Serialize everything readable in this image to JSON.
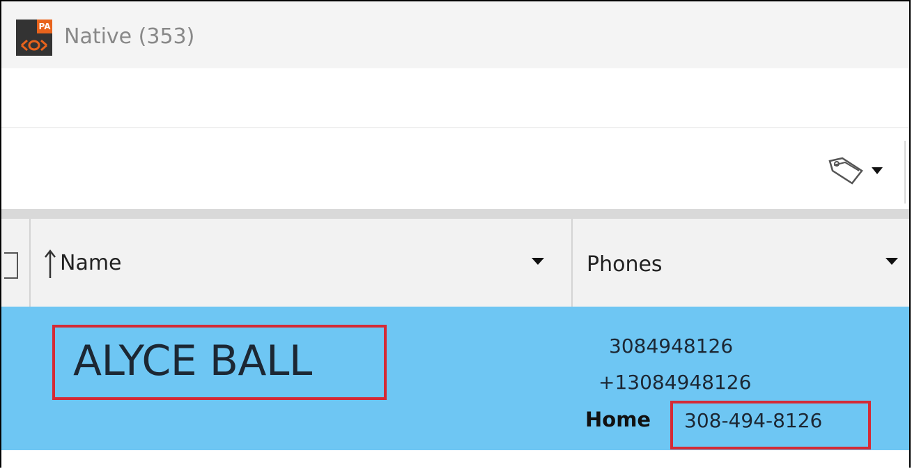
{
  "window": {
    "title": "Native (353)",
    "logo_text": "PA"
  },
  "toolbar": {
    "tag_icon": "tag-icon"
  },
  "table": {
    "columns": [
      {
        "label": "Name",
        "sort": "ascending"
      },
      {
        "label": "Phones"
      }
    ],
    "rows": [
      {
        "name": "ALYCE BALL",
        "phones": [
          "3084948126",
          "+13084948126"
        ],
        "labeled_phone": {
          "label": "Home",
          "value": "308-494-8126"
        },
        "selected": true
      }
    ]
  },
  "colors": {
    "selection": "#6ec6f3",
    "highlight_box": "#d42a36",
    "logo_accent": "#e8631c"
  }
}
